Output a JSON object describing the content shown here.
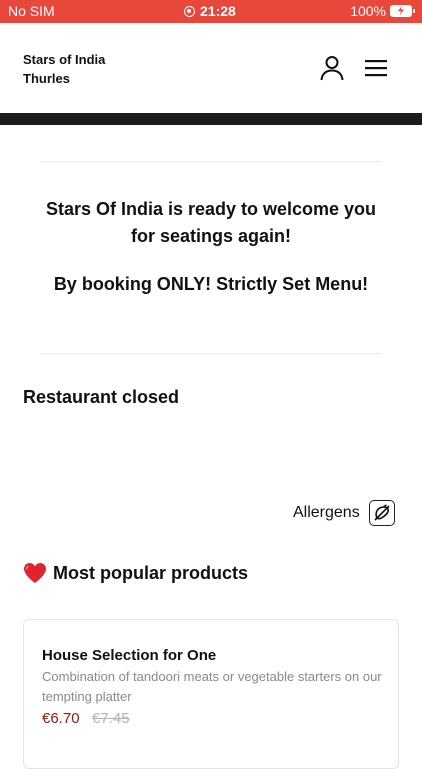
{
  "status_bar": {
    "carrier": "No SIM",
    "time": "21:28",
    "battery": "100%",
    "background_color": "#e8473c"
  },
  "header": {
    "brand_line1": "Stars of India",
    "brand_line2": "Thurles",
    "icons": [
      "user-icon",
      "menu-icon"
    ]
  },
  "announcement": {
    "line1": "Stars Of India is ready to welcome you for seatings again!",
    "line2": "By booking ONLY! Strictly Set Menu!"
  },
  "restaurant_status": "Restaurant closed",
  "allergens": {
    "label": "Allergens",
    "icon": "allergen-icon"
  },
  "popular_section": {
    "title": "Most popular products",
    "icon": "heart-icon"
  },
  "products": [
    {
      "name": "House Selection for One",
      "description": "Combination of tandoori meats or vegetable starters on our tempting platter",
      "price": "€6.70",
      "old_price": "€7.45"
    }
  ],
  "colors": {
    "accent": "#e8473c",
    "price": "#8b1a12",
    "muted_text": "#8a8a8a"
  }
}
